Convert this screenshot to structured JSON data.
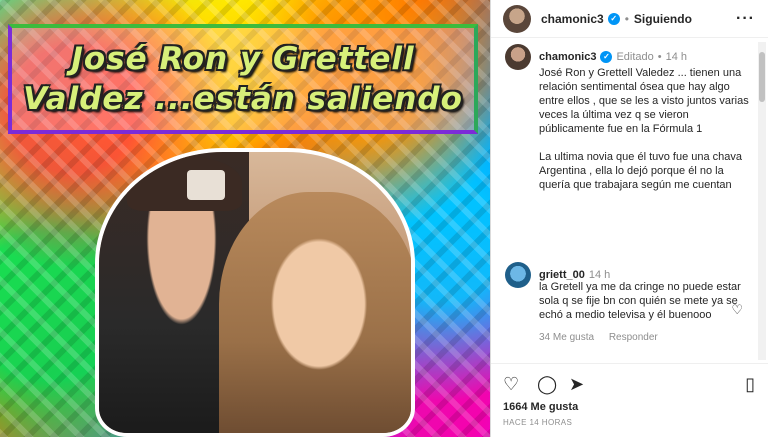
{
  "media": {
    "title_line1": "José Ron y Grettell",
    "title_line2": "Valdez ...están saliendo"
  },
  "header": {
    "username": "chamonic3",
    "dot": "•",
    "follow_label": "Siguiendo",
    "more_icon": "more-options-icon"
  },
  "caption": {
    "username": "chamonic3",
    "edited": "Editado",
    "dot": "•",
    "age": "14 h",
    "text": "José Ron y Grettell Valedez ... tienen una relación sentimental ósea que hay algo entre ellos , que se les a visto juntos varias veces la última vez q se vieron públicamente fue en la Fórmula 1\n\nLa ultima novia que él tuvo fue una chava Argentina , ella lo dejó porque él no la quería que trabajara según me cuentan"
  },
  "comment": {
    "username": "griett_00",
    "age": "14 h",
    "text": "la Gretell ya me da cringe no puede estar sola q se fije bn con quién se mete ya se echó a medio televisa y él buenooo",
    "likes": "34 Me gusta",
    "reply": "Responder"
  },
  "actions": {
    "like_icon": "heart-icon",
    "comment_icon": "comment-icon",
    "share_icon": "share-icon",
    "save_icon": "bookmark-icon"
  },
  "likes": "1664 Me gusta",
  "timestamp": "HACE 14 HORAS",
  "colors": {
    "verified": "#0095f6",
    "muted": "#8e8e8e",
    "text": "#262626"
  }
}
